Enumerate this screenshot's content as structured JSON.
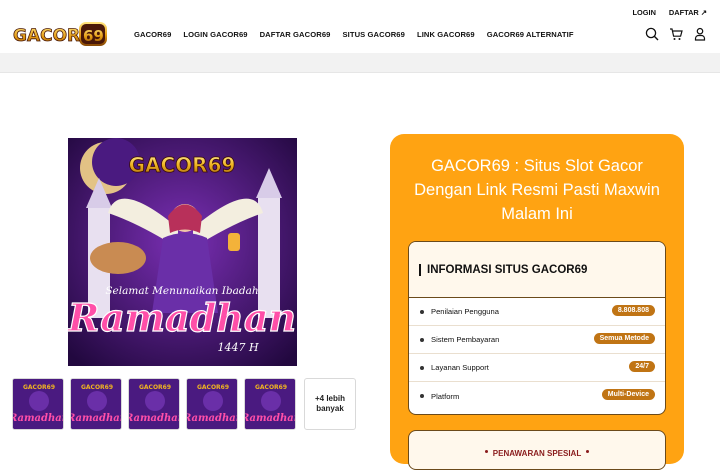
{
  "header": {
    "logo_text": "GACOR69",
    "nav": [
      "GACOR69",
      "LOGIN GACOR69",
      "DAFTAR GACOR69",
      "SITUS GACOR69",
      "LINK GACOR69",
      "GACOR69 ALTERNATIF"
    ],
    "top_links": {
      "login": "LOGIN",
      "daftar": "DAFTAR ↗"
    },
    "icons": [
      "search-icon",
      "cart-icon",
      "user-icon"
    ]
  },
  "gallery": {
    "main_image": {
      "logo_text": "GACOR69",
      "greeting": "Selamat Menunaikan Ibadah",
      "title": "Ramadhan",
      "year": "1447 H"
    },
    "thumbnail_count": 5,
    "more_label": "+4 lebih banyak"
  },
  "product": {
    "title": "GACOR69 : Situs Slot Gacor Dengan Link Resmi Pasti Maxwin Malam Ini",
    "info_title": "INFORMASI SITUS GACOR69",
    "rows": [
      {
        "label": "Penilaian Pengguna",
        "value": "8.808.808"
      },
      {
        "label": "Sistem Pembayaran",
        "value": "Semua Metode"
      },
      {
        "label": "Layanan Support",
        "value": "24/7"
      },
      {
        "label": "Platform",
        "value": "Multi-Device"
      }
    ],
    "offer_title": "PENAWARAN SPESIAL"
  },
  "colors": {
    "card": "#ffa312",
    "badge": "#c07414",
    "poster_bg": "#3c1470",
    "accent_pink": "#ff4fa8"
  }
}
